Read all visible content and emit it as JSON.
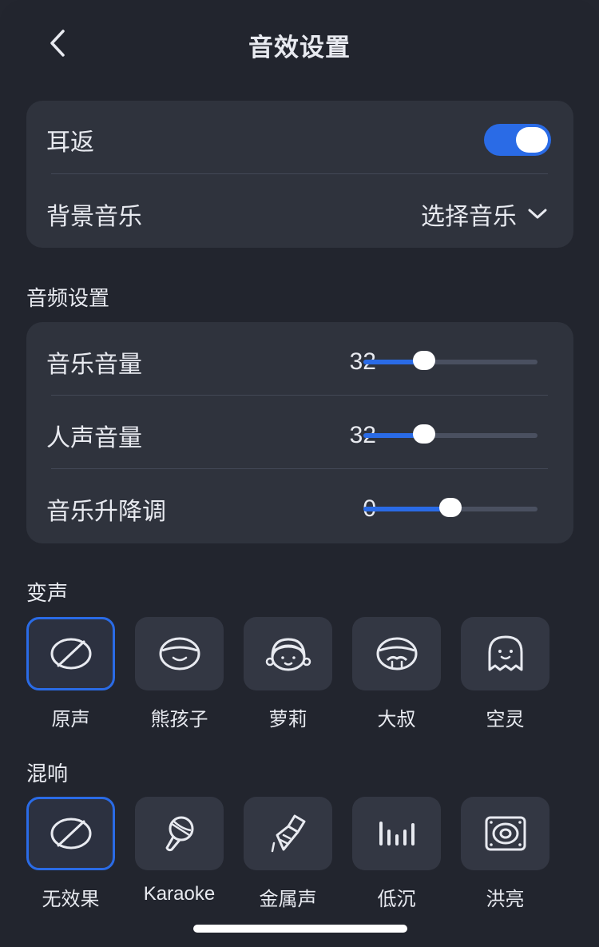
{
  "header": {
    "title": "音效设置",
    "back_icon": "chevron-left-icon"
  },
  "general": {
    "ear_return": {
      "label": "耳返",
      "enabled": true
    },
    "bgm": {
      "label": "背景音乐",
      "select_label": "选择音乐"
    }
  },
  "audio": {
    "section_label": "音频设置",
    "sliders": [
      {
        "label": "音乐音量",
        "value": "32",
        "fraction": 0.35
      },
      {
        "label": "人声音量",
        "value": "32",
        "fraction": 0.35
      },
      {
        "label": "音乐升降调",
        "value": "0",
        "fraction": 0.5
      }
    ]
  },
  "voice_change": {
    "section_label": "变声",
    "options": [
      {
        "name": "原声",
        "icon": "no-effect-icon",
        "selected": true
      },
      {
        "name": "熊孩子",
        "icon": "child-face-icon",
        "selected": false
      },
      {
        "name": "萝莉",
        "icon": "girl-face-icon",
        "selected": false
      },
      {
        "name": "大叔",
        "icon": "uncle-face-icon",
        "selected": false
      },
      {
        "name": "空灵",
        "icon": "ghost-icon",
        "selected": false
      }
    ]
  },
  "reverb": {
    "section_label": "混响",
    "options": [
      {
        "name": "无效果",
        "icon": "no-effect-icon",
        "selected": true
      },
      {
        "name": "Karaoke",
        "icon": "microphone-icon",
        "selected": false
      },
      {
        "name": "金属声",
        "icon": "metal-horn-icon",
        "selected": false
      },
      {
        "name": "低沉",
        "icon": "sound-bars-icon",
        "selected": false
      },
      {
        "name": "洪亮",
        "icon": "speaker-icon",
        "selected": false
      }
    ]
  },
  "colors": {
    "accent": "#2a6be6",
    "background": "#22252e",
    "card": "#2f333d"
  }
}
